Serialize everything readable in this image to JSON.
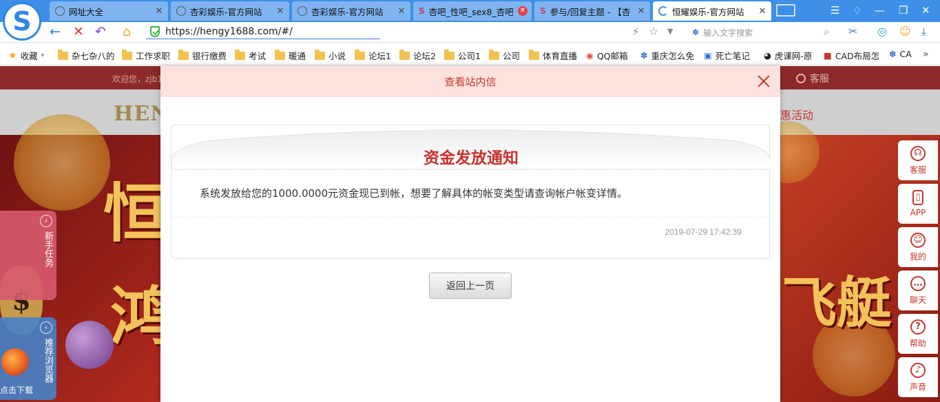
{
  "browser": {
    "tabs": [
      {
        "title": "网址大全",
        "active": false
      },
      {
        "title": "杏彩娱乐-官方网站",
        "active": false
      },
      {
        "title": "杏彩娱乐-官方网站",
        "active": false
      },
      {
        "title": "杏吧_性吧_sex8_杏吧",
        "active": false
      },
      {
        "title": "参与/回复主题 - 【杏",
        "active": false
      },
      {
        "title": "恒耀娱乐-官方网站",
        "active": true
      }
    ],
    "url": "https://hengy1688.com/#/",
    "search_placeholder": "输入文字搜索",
    "bookmarks": [
      "收藏",
      "杂七杂八的",
      "工作求职",
      "银行缴费",
      "考试",
      "暖通",
      "小说",
      "论坛1",
      "论坛2",
      "公司1",
      "公司",
      "体育直播",
      "QQ邮箱",
      "重庆怎么免",
      "死亡笔记",
      "虎课网-原",
      "CAD布局怎",
      "CA"
    ]
  },
  "site": {
    "welcome": "欢迎您，zjb1",
    "logo": "HENG",
    "kefu": "客服",
    "promo": "惠活动",
    "left_side": [
      {
        "label": "新手任务",
        "icon": "›"
      },
      {
        "label": "推荐浏览器",
        "icon": "‹"
      }
    ],
    "download": "点击下载",
    "right_side": [
      {
        "label": "客服",
        "icon": "☊"
      },
      {
        "label": "APP",
        "icon": "▯"
      },
      {
        "label": "我的",
        "icon": "☺"
      },
      {
        "label": "聊天",
        "icon": "…"
      },
      {
        "label": "帮助",
        "icon": "?"
      },
      {
        "label": "声音",
        "icon": "♪"
      }
    ]
  },
  "modal": {
    "title": "查看站内信",
    "notice_title": "资金发放通知",
    "body": "系统发放给您的1000.0000元资金现已到帐，想要了解具体的帐变类型请查询帐户帐变详情。",
    "time": "2019-07-29 17:42:39",
    "back_label": "返回上一页"
  }
}
